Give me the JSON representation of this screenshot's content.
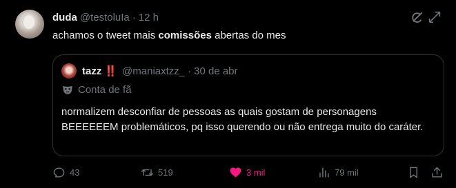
{
  "post": {
    "author_name": "duda",
    "handle": "@testoluIa",
    "separator": "·",
    "time": "12 h",
    "text_before": "achamos o tweet mais",
    "text_bold": "comissões",
    "text_after": "abertas do mes"
  },
  "quote": {
    "author_name": "tazz",
    "emoji": "‼️",
    "handle": "@maniaxtzz_",
    "separator": "·",
    "date": "30 de abr",
    "label": "Conta de fã",
    "text": "normalizem desconfiar de pessoas as quais gostam de personagens BEEEEEEM problemáticos, pq isso querendo ou não entrega muito do caráter."
  },
  "actions": {
    "replies": "43",
    "reposts": "519",
    "likes": "3 mil",
    "views": "79 mil"
  },
  "colors": {
    "background": "#000000",
    "text": "#e7e9ea",
    "muted": "#71767b",
    "border": "#2f3336",
    "like": "#f91880",
    "emoji_red": "#f4212e"
  },
  "icons": [
    "grok-icon",
    "more-icon",
    "mask-icon",
    "reply-icon",
    "repost-icon",
    "heart-icon",
    "views-icon",
    "bookmark-icon",
    "share-icon"
  ]
}
